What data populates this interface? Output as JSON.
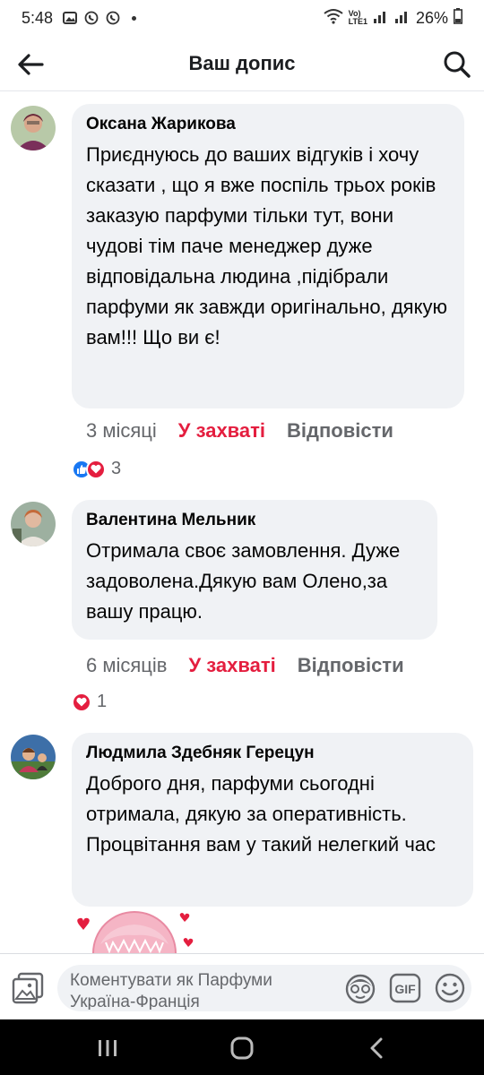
{
  "status_bar": {
    "time": "5:48",
    "battery": "26%"
  },
  "header": {
    "title": "Ваш допис"
  },
  "comments": [
    {
      "author": "Оксана Жарикова",
      "text": "Приєднуюсь до ваших відгуків і хочу сказати , що я вже поспіль трьох років заказую парфуми тільки тут, вони чудові тім паче менеджер дуже відповідальна людина ,підібрали парфуми як завжди оригінально, дякую вам!!!  Що ви є!",
      "time": "3 місяці",
      "like_label": "У захваті",
      "reply_label": "Відповісти",
      "reaction_count": "3"
    },
    {
      "author": "Валентина Мельник",
      "text": "Отримала своє замовлення. Дуже задоволена.Дякую вам Олено,за вашу працю.",
      "time": "6 місяців",
      "like_label": "У захваті",
      "reply_label": "Відповісти",
      "reaction_count": "1"
    },
    {
      "author": "Людмила Здебняк Герецун",
      "text": "Доброго дня, парфуми сьогодні отримала, дякую за оперативність. Процвітання вам у такий нелегкий час"
    }
  ],
  "compose": {
    "placeholder": "Коментувати як Парфуми Україна-Франція",
    "gif_label": "GIF"
  },
  "colors": {
    "accent_love": "#e41e3f",
    "like_blue": "#1877f2",
    "bubble_bg": "#f0f2f5",
    "meta_gray": "#65676b"
  },
  "icons": [
    "back-arrow-icon",
    "search-icon",
    "photo-icon",
    "avatar-sticker-icon",
    "gif-icon",
    "emoji-icon",
    "recent-apps-icon",
    "home-icon",
    "back-nav-icon"
  ]
}
